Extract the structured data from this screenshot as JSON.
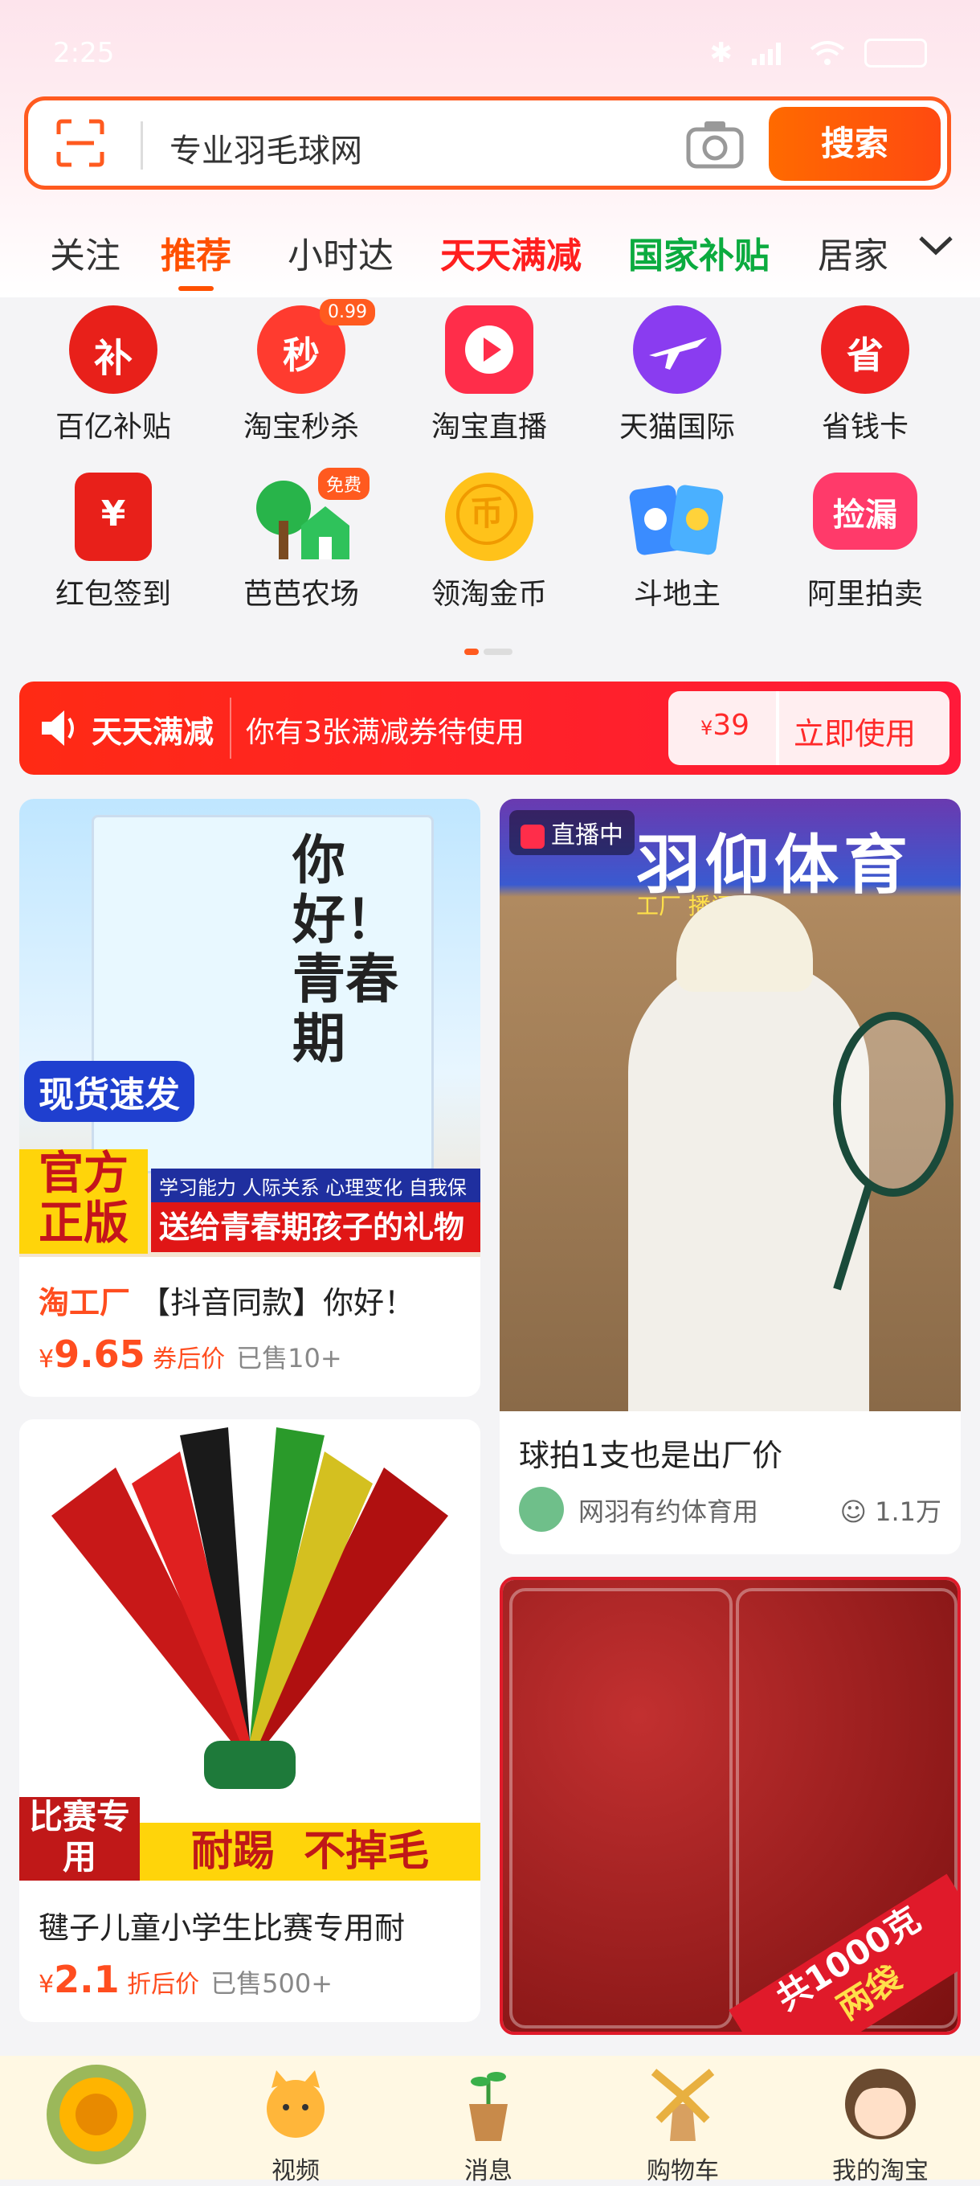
{
  "status": {
    "time": "2:25"
  },
  "search": {
    "query": "专业羽毛球网",
    "button": "搜索"
  },
  "tabs": [
    "关注",
    "推荐",
    "小时达",
    "天天满减",
    "国家补贴",
    "居家"
  ],
  "grid": [
    {
      "label": "百亿补贴",
      "icon": "subsidy-icon"
    },
    {
      "label": "淘宝秒杀",
      "icon": "flash-sale-icon",
      "badge": "0.99"
    },
    {
      "label": "淘宝直播",
      "icon": "live-icon"
    },
    {
      "label": "天猫国际",
      "icon": "tmall-global-icon"
    },
    {
      "label": "省钱卡",
      "icon": "savings-card-icon"
    },
    {
      "label": "红包签到",
      "icon": "red-packet-icon"
    },
    {
      "label": "芭芭农场",
      "icon": "farm-icon",
      "badge": "免费"
    },
    {
      "label": "领淘金币",
      "icon": "gold-coin-icon"
    },
    {
      "label": "斗地主",
      "icon": "cards-game-icon"
    },
    {
      "label": "阿里拍卖",
      "icon": "auction-icon",
      "icon_text": "捡漏"
    }
  ],
  "banner": {
    "title": "天天满减",
    "text": "你有3张满减券待使用",
    "currency": "¥",
    "amount": "39",
    "action": "立即使用"
  },
  "products": {
    "book": {
      "img_title": "你好！青春期",
      "tag1": "现货速发",
      "tag2": "官方正版",
      "strip1": "学习能力 人际关系 心理变化 自我保护",
      "strip2": "送给青春期孩子的礼物",
      "brand": "淘工厂",
      "title": "【抖音同款】你好！",
      "currency": "¥",
      "price": "9.65",
      "price_note": "券后价",
      "sold": "已售10+"
    },
    "live": {
      "badge": "直播中",
      "sign": "羽仰体育",
      "sign_sub": "工厂 播间",
      "title": "球拍1支也是出厂价",
      "shop": "网羽有约体育用",
      "viewers": "1.1万"
    },
    "shuttle": {
      "tag": "比赛专用",
      "slogan": "耐踢  不掉毛",
      "title": "毽子儿童小学生比赛专用耐",
      "currency": "¥",
      "price": "2.1",
      "price_note": "折后价",
      "sold": "已售500+"
    },
    "dates": {
      "corner1": "共1000克",
      "corner2": "两袋"
    }
  },
  "bottom_nav": [
    {
      "label": "",
      "icon": "sunflower-home-icon"
    },
    {
      "label": "视频",
      "icon": "cat-video-icon"
    },
    {
      "label": "消息",
      "icon": "plant-message-icon"
    },
    {
      "label": "购物车",
      "icon": "windmill-cart-icon"
    },
    {
      "label": "我的淘宝",
      "icon": "avatar-profile-icon"
    }
  ]
}
